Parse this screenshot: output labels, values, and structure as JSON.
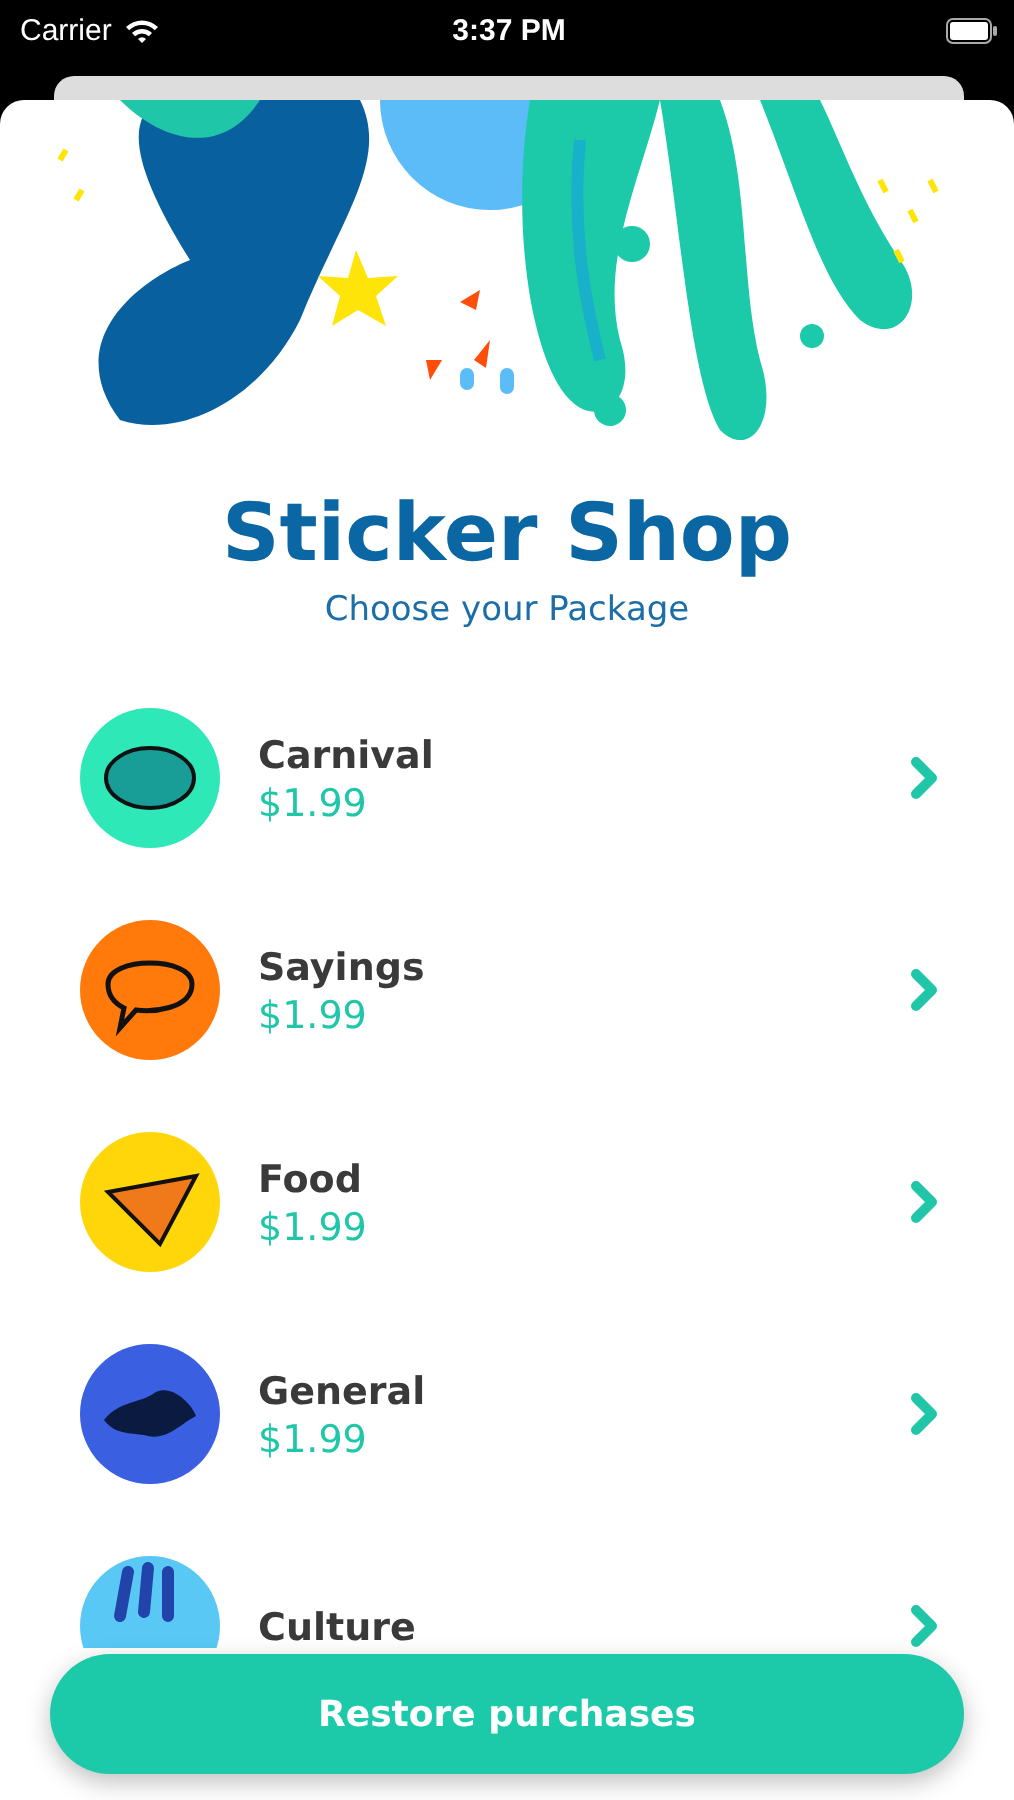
{
  "status_bar": {
    "carrier": "Carrier",
    "time": "3:37 PM"
  },
  "title": "Sticker Shop",
  "subtitle": "Choose your Package",
  "packages": [
    {
      "name": "Carnival",
      "price": "$1.99",
      "color": "#2ee8b8"
    },
    {
      "name": "Sayings",
      "price": "$1.99",
      "color": "#ff7a0a"
    },
    {
      "name": "Food",
      "price": "$1.99",
      "color": "#ffd60a"
    },
    {
      "name": "General",
      "price": "$1.99",
      "color": "#3a5fe0"
    },
    {
      "name": "Culture",
      "color": "#5ac8f5"
    }
  ],
  "restore_button": "Restore purchases"
}
